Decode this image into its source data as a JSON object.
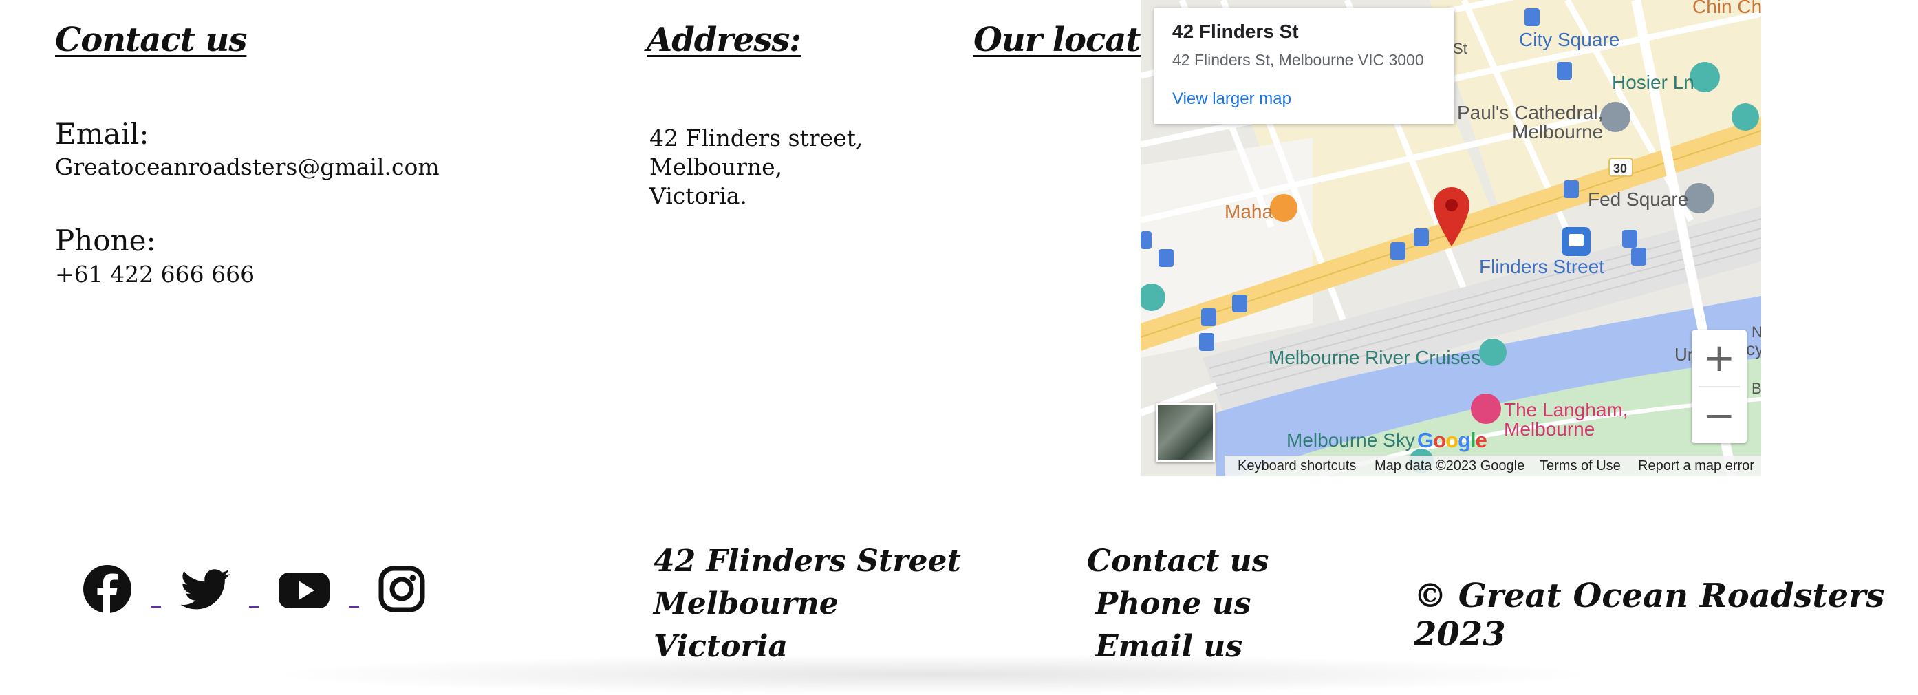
{
  "contact": {
    "heading": "Contact us",
    "email_label": "Email:",
    "email_value": "Greatoceanroadsters@gmail.com",
    "phone_label": "Phone:",
    "phone_value": "+61 422 666 666"
  },
  "address": {
    "heading": "Address:",
    "line1": "42 Flinders street,",
    "line2": "Melbourne,",
    "line3": "Victoria."
  },
  "location": {
    "heading": "Our location"
  },
  "map": {
    "card_title": "42 Flinders St",
    "card_address": "42 Flinders St, Melbourne VIC 3000",
    "card_link": "View larger map",
    "labels": {
      "city_square": "City Square",
      "chin_chin": "Chin Chi",
      "hosier_ln": "Hosier Ln",
      "st_pauls_1": "Paul's Cathedral,",
      "st_pauls_2": "Melbourne",
      "fed_square": "Fed Square",
      "maha": "Maha",
      "flinders_street": "Flinders Street",
      "river_cruises": "Melbourne River Cruises",
      "langham_1": "The Langham,",
      "langham_2": "Melbourne",
      "skydeck": "Melbourne Sky",
      "route_30": "30",
      "street_st": "St",
      "edge_ur": "Ur",
      "edge_cy": "cy",
      "edge_n": "N",
      "edge_b": "B"
    },
    "google_logo": "Google",
    "zoom_in": "+",
    "zoom_out": "−",
    "footer": {
      "keyboard": "Keyboard shortcuts",
      "map_data": "Map data ©2023 Google",
      "terms": "Terms of Use",
      "report": "Report a map error"
    },
    "colors": {
      "water": "#a9c1f2",
      "main_road": "#f8d57e",
      "land": "#ebe9e4",
      "block": "#f7efd2",
      "park": "#cde9c9",
      "pin": "#d93025"
    }
  },
  "footer": {
    "social_icons": [
      "facebook-icon",
      "twitter-icon",
      "youtube-icon",
      "instagram-icon"
    ],
    "address_line1": "42 Flinders Street",
    "address_line2": "Melbourne",
    "address_line3": "Victoria",
    "contact_link": "Contact us",
    "phone_link": "Phone us",
    "email_link": "Email us",
    "copyright": "© Great Ocean Roadsters 2023"
  }
}
